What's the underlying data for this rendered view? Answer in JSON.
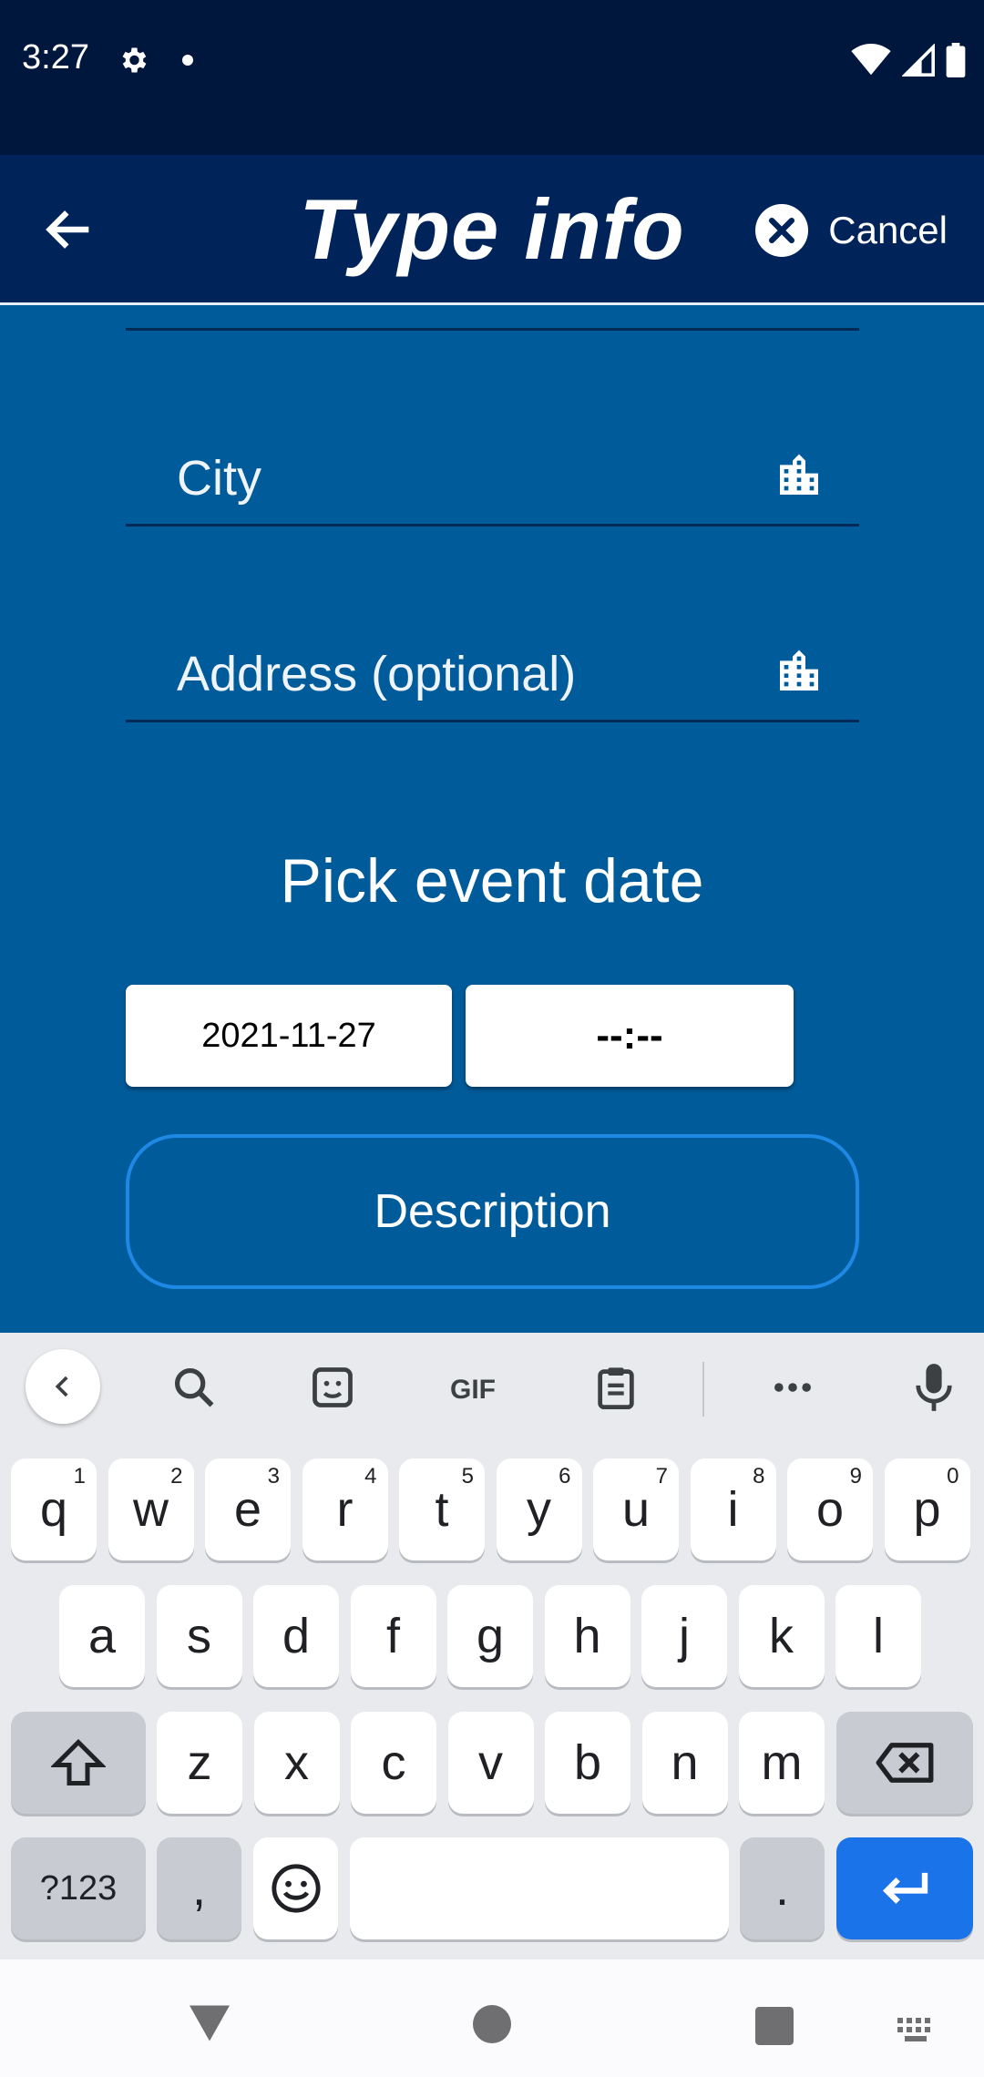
{
  "status_bar": {
    "time": "3:27"
  },
  "app_bar": {
    "title": "Type info",
    "cancel_label": "Cancel"
  },
  "form": {
    "city_label": "City",
    "address_label": "Address (optional)",
    "section_title": "Pick event date",
    "date_value": "2021-11-27",
    "time_value": "--:--",
    "description_label": "Description"
  },
  "keyboard": {
    "row1": [
      {
        "k": "q",
        "s": "1"
      },
      {
        "k": "w",
        "s": "2"
      },
      {
        "k": "e",
        "s": "3"
      },
      {
        "k": "r",
        "s": "4"
      },
      {
        "k": "t",
        "s": "5"
      },
      {
        "k": "y",
        "s": "6"
      },
      {
        "k": "u",
        "s": "7"
      },
      {
        "k": "i",
        "s": "8"
      },
      {
        "k": "o",
        "s": "9"
      },
      {
        "k": "p",
        "s": "0"
      }
    ],
    "row2": [
      "a",
      "s",
      "d",
      "f",
      "g",
      "h",
      "j",
      "k",
      "l"
    ],
    "row3": [
      "z",
      "x",
      "c",
      "v",
      "b",
      "n",
      "m"
    ],
    "symbols_label": "?123",
    "comma": ",",
    "period": "."
  },
  "colors": {
    "status_bar": "#00173d",
    "app_bar": "#00245a",
    "form_background": "#005b9a",
    "accent": "#1a73e8"
  }
}
